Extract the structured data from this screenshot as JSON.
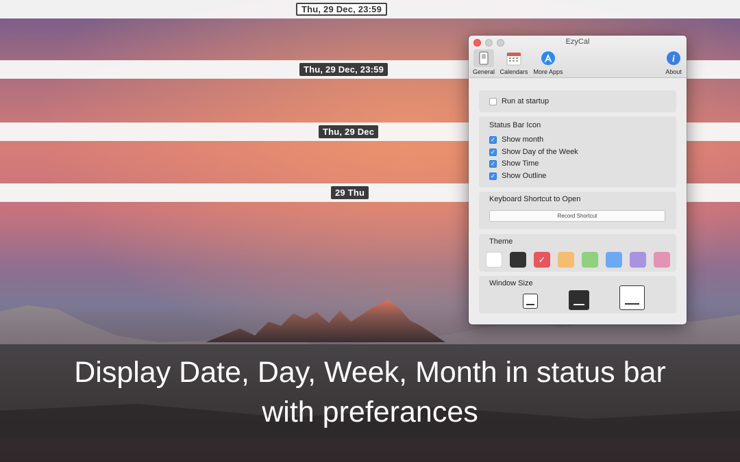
{
  "status_clocks": [
    {
      "text": "Thu, 29 Dec, 23:59",
      "style": "outline"
    },
    {
      "text": "Thu, 29 Dec, 23:59",
      "style": "dark"
    },
    {
      "text": "Thu, 29 Dec",
      "style": "dark"
    },
    {
      "text": "29 Thu",
      "style": "dark"
    }
  ],
  "window": {
    "title": "EzyCal",
    "toolbar": {
      "general": "General",
      "calendars": "Calendars",
      "more_apps": "More Apps",
      "about": "About"
    },
    "run_at_startup": {
      "label": "Run at startup",
      "checked": false
    },
    "status_bar_icon": {
      "heading": "Status Bar Icon",
      "options": [
        {
          "label": "Show month",
          "checked": true
        },
        {
          "label": "Show Day of the Week",
          "checked": true
        },
        {
          "label": "Show Time",
          "checked": true
        },
        {
          "label": "Show Outline",
          "checked": true
        }
      ]
    },
    "keyboard_shortcut": {
      "heading": "Keyboard Shortcut to Open",
      "button": "Record Shortcut"
    },
    "theme": {
      "heading": "Theme",
      "swatches": [
        "#ffffff",
        "#333333",
        "#e8555a",
        "#f5be6e",
        "#8fd17d",
        "#6ba9f2",
        "#a993e0",
        "#e394b4"
      ],
      "selected_index": 2
    },
    "window_size": {
      "heading": "Window Size",
      "selected": "medium"
    }
  },
  "caption": {
    "line1": "Display Date, Day, Week, Month in status bar",
    "line2": "with preferances"
  },
  "colors": {
    "accent": "#3d8ff6",
    "close": "#fc5f57"
  }
}
